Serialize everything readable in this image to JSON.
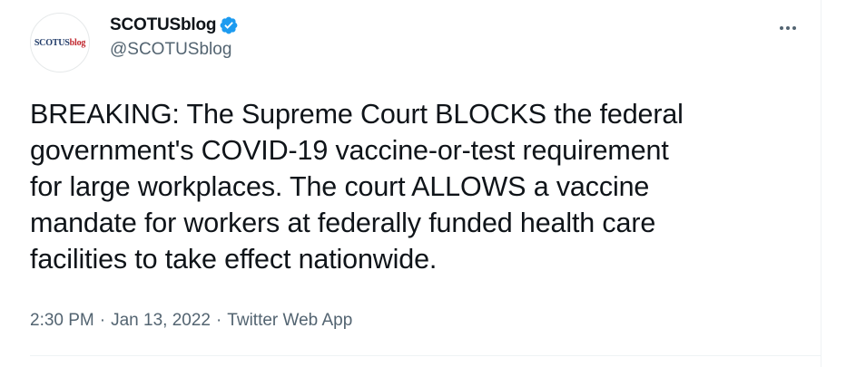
{
  "tweet": {
    "author": {
      "display_name": "SCOTUSblog",
      "handle": "@SCOTUSblog",
      "verified": true,
      "avatar_logo_main": "SCOTUS",
      "avatar_logo_accent": "blog"
    },
    "text": "BREAKING: The Supreme Court BLOCKS the federal\ngovernment's COVID-19 vaccine-or-test requirement\nfor large workplaces. The court ALLOWS a vaccine\nmandate for workers at federally funded health care\nfacilities to take effect nationwide.",
    "time": "2:30 PM",
    "date": "Jan 13, 2022",
    "source": "Twitter Web App",
    "separator": "·"
  },
  "icons": {
    "verified": "verified-badge-icon",
    "more": "more-options-icon"
  },
  "colors": {
    "verified_blue": "#1d9bf0",
    "text_primary": "#0f1419",
    "text_secondary": "#536471",
    "logo_navy": "#1f3a68",
    "logo_red": "#c0262d"
  }
}
